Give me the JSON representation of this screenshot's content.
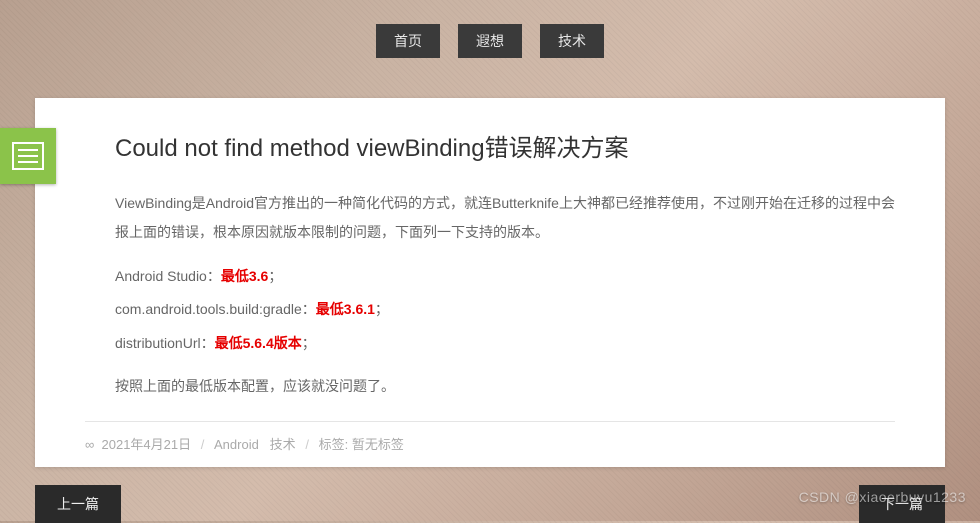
{
  "nav": {
    "items": [
      "首页",
      "遐想",
      "技术"
    ]
  },
  "article": {
    "title": "Could not find method viewBinding错误解决方案",
    "intro": "ViewBinding是Android官方推出的一种简化代码的方式，就连Butterknife上大神都已经推荐使用，不过刚开始在迁移的过程中会报上面的错误，根本原因就版本限制的问题，下面列一下支持的版本。",
    "reqs": [
      {
        "label": "Android Studio：",
        "value": "最低3.6",
        "tail": "；"
      },
      {
        "label": "com.android.tools.build:gradle：",
        "value": "最低3.6.1",
        "tail": "；"
      },
      {
        "label": "distributionUrl：",
        "value": "最低5.6.4版本",
        "tail": "；"
      }
    ],
    "outro": "按照上面的最低版本配置，应该就没问题了。"
  },
  "meta": {
    "link_icon": "∞",
    "date": "2021年4月21日",
    "cat1": "Android",
    "cat2": "技术",
    "tags_label": "标签:",
    "tags_value": "暂无标签"
  },
  "pager": {
    "prev": "上一篇",
    "next": "下一篇"
  },
  "watermark": "CSDN @xiaoerbuyu1233",
  "icon_name": "list-icon"
}
